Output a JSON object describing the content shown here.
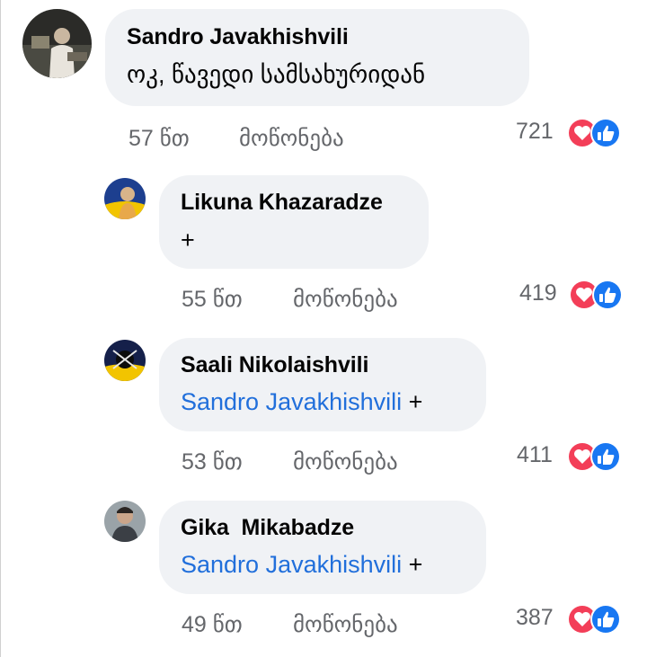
{
  "colors": {
    "mention": "#216fdb",
    "bubble": "#f0f2f5",
    "meta": "#65676b",
    "love": "#f33e58",
    "like": "#1877f2"
  },
  "comments": [
    {
      "author": "Sandro Javakhishvili",
      "text": "ოკ, წავედი სამსახურიდან",
      "mention": "",
      "suffix": "",
      "time": "57 წთ",
      "like_label": "მოწონება",
      "reactions": "721",
      "reaction_icons": [
        "love-icon",
        "like-icon"
      ]
    },
    {
      "author": "Likuna Khazaradze",
      "text": "+",
      "mention": "",
      "suffix": "",
      "time": "55 წთ",
      "like_label": "მოწონება",
      "reactions": "419",
      "reaction_icons": [
        "love-icon",
        "like-icon"
      ]
    },
    {
      "author": "Saali Nikolaishvili",
      "text": "",
      "mention": "Sandro Javakhishvili",
      "suffix": " +",
      "time": "53 წთ",
      "like_label": "მოწონება",
      "reactions": "411",
      "reaction_icons": [
        "love-icon",
        "like-icon"
      ]
    },
    {
      "author": "Gika  Mikabadze",
      "text": "",
      "mention": "Sandro Javakhishvili",
      "suffix": " +",
      "time": "49 წთ",
      "like_label": "მოწონება",
      "reactions": "387",
      "reaction_icons": [
        "love-icon",
        "like-icon"
      ]
    }
  ]
}
